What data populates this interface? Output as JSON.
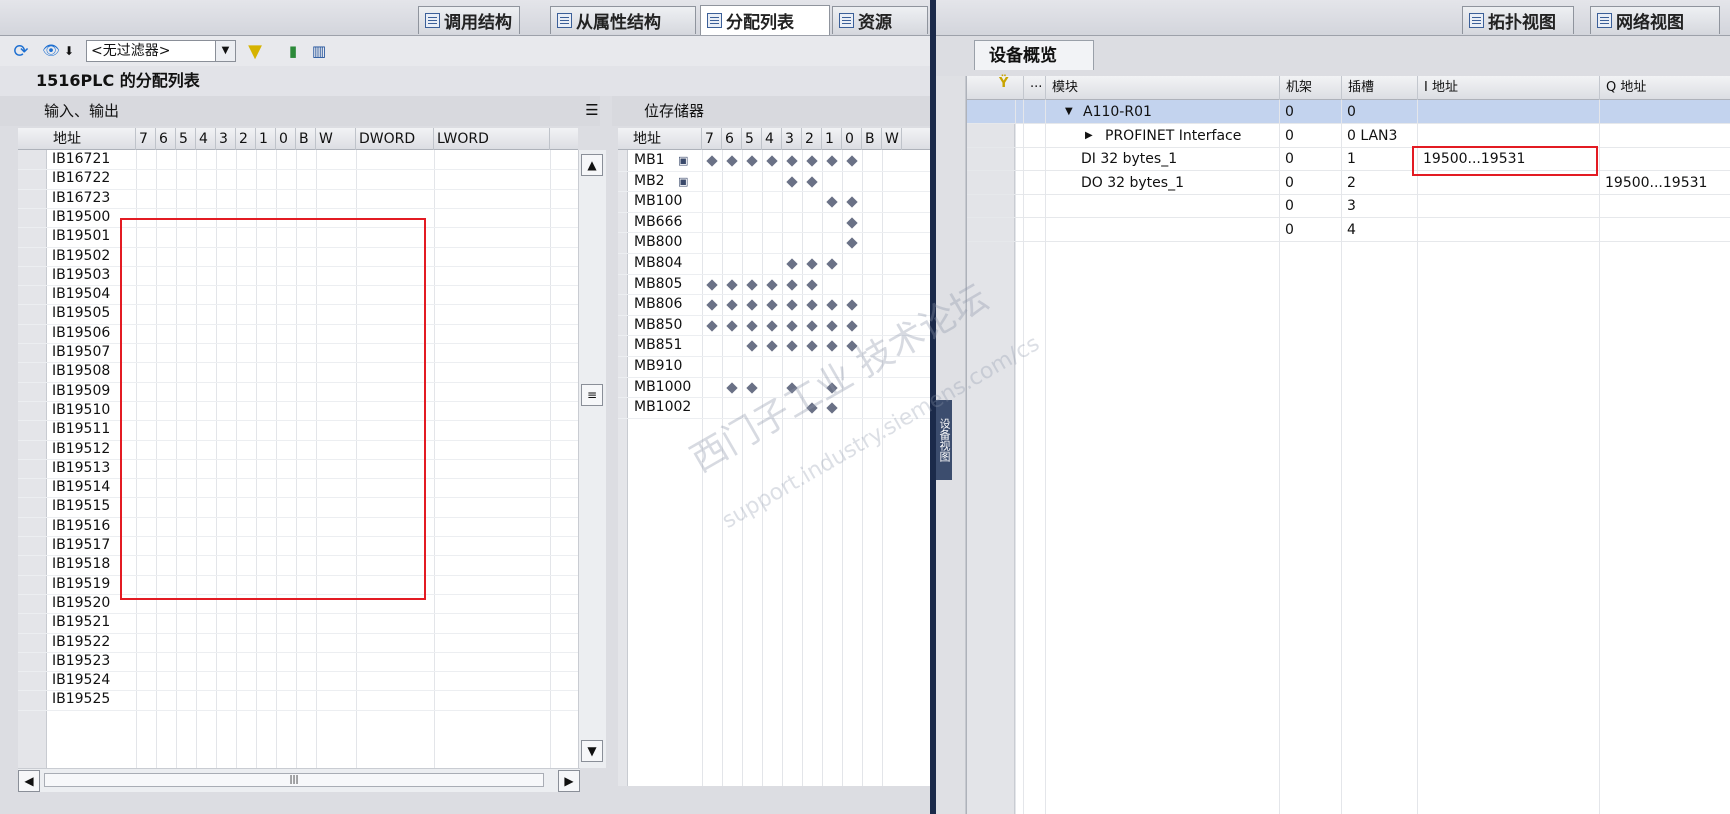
{
  "top_tabs": [
    {
      "label": "调用结构",
      "active": false
    },
    {
      "label": "从属性结构",
      "active": false
    },
    {
      "label": "分配列表",
      "active": true
    },
    {
      "label": "资源",
      "active": false
    }
  ],
  "right_top_buttons": [
    "拓扑视图",
    "网络视图"
  ],
  "toolbar": {
    "filter_value": "<无过滤器>"
  },
  "panel_title": "1516PLC 的分配列表",
  "io_section_label": "输入、输出",
  "mem_section_label": "位存储器",
  "io_table": {
    "headers": [
      "地址",
      "7",
      "6",
      "5",
      "4",
      "3",
      "2",
      "1",
      "0",
      "B",
      "W",
      "DWORD",
      "LWORD"
    ],
    "rows": [
      "IB16721",
      "IB16722",
      "IB16723",
      "IB19500",
      "IB19501",
      "IB19502",
      "IB19503",
      "IB19504",
      "IB19505",
      "IB19506",
      "IB19507",
      "IB19508",
      "IB19509",
      "IB19510",
      "IB19511",
      "IB19512",
      "IB19513",
      "IB19514",
      "IB19515",
      "IB19516",
      "IB19517",
      "IB19518",
      "IB19519",
      "IB19520",
      "IB19521",
      "IB19522",
      "IB19523",
      "IB19524",
      "IB19525"
    ]
  },
  "mem_table": {
    "headers": [
      "地址",
      "7",
      "6",
      "5",
      "4",
      "3",
      "2",
      "1",
      "0",
      "B",
      "W"
    ],
    "rows": [
      {
        "addr": "MB1",
        "bits": [
          1,
          1,
          1,
          1,
          1,
          1,
          1,
          1
        ]
      },
      {
        "addr": "MB2",
        "bits": [
          0,
          0,
          0,
          0,
          1,
          1,
          0,
          0
        ]
      },
      {
        "addr": "MB100",
        "bits": [
          0,
          0,
          0,
          0,
          0,
          0,
          1,
          1
        ]
      },
      {
        "addr": "MB666",
        "bits": [
          0,
          0,
          0,
          0,
          0,
          0,
          0,
          1
        ]
      },
      {
        "addr": "MB800",
        "bits": [
          0,
          0,
          0,
          0,
          0,
          0,
          0,
          1
        ]
      },
      {
        "addr": "MB804",
        "bits": [
          0,
          0,
          0,
          0,
          1,
          1,
          1,
          0
        ]
      },
      {
        "addr": "MB805",
        "bits": [
          1,
          1,
          1,
          1,
          1,
          1,
          0,
          0
        ]
      },
      {
        "addr": "MB806",
        "bits": [
          1,
          1,
          1,
          1,
          1,
          1,
          1,
          1
        ]
      },
      {
        "addr": "MB850",
        "bits": [
          1,
          1,
          1,
          1,
          1,
          1,
          1,
          1
        ]
      },
      {
        "addr": "MB851",
        "bits": [
          0,
          0,
          1,
          1,
          1,
          1,
          1,
          1
        ]
      },
      {
        "addr": "MB910",
        "bits": [
          0,
          0,
          0,
          0,
          0,
          0,
          0,
          0
        ]
      },
      {
        "addr": "MB1000",
        "bits": [
          0,
          1,
          1,
          0,
          1,
          0,
          1,
          0
        ]
      },
      {
        "addr": "MB1002",
        "bits": [
          0,
          0,
          0,
          0,
          0,
          1,
          1,
          0
        ]
      }
    ]
  },
  "device_overview": {
    "tab_label": "设备概览",
    "side_tab_label": "设备视图",
    "headers": [
      "...",
      "模块",
      "机架",
      "插槽",
      "I 地址",
      "Q 地址"
    ],
    "rows": [
      {
        "module": "A110-R01",
        "rack": "0",
        "slot": "0",
        "i_addr": "",
        "q_addr": "",
        "selected": true,
        "expander": "▼"
      },
      {
        "module": "PROFINET Interface",
        "rack": "0",
        "slot": "0 LAN3",
        "i_addr": "",
        "q_addr": "",
        "selected": false,
        "expander": "▶"
      },
      {
        "module": "DI 32 bytes_1",
        "rack": "0",
        "slot": "1",
        "i_addr": "19500...19531",
        "q_addr": "",
        "selected": false,
        "expander": ""
      },
      {
        "module": "DO 32 bytes_1",
        "rack": "0",
        "slot": "2",
        "i_addr": "",
        "q_addr": "19500...19531",
        "selected": false,
        "expander": ""
      },
      {
        "module": "",
        "rack": "0",
        "slot": "3",
        "i_addr": "",
        "q_addr": "",
        "selected": false,
        "expander": ""
      },
      {
        "module": "",
        "rack": "0",
        "slot": "4",
        "i_addr": "",
        "q_addr": "",
        "selected": false,
        "expander": ""
      }
    ]
  },
  "watermark": {
    "line1": "西门子工业 技术论坛",
    "line2": "support.industry.siemens.com/cs"
  },
  "colors": {
    "highlight": "#e31b23",
    "selected_row": "#c3d3ee",
    "diamond": "#6a7186"
  }
}
